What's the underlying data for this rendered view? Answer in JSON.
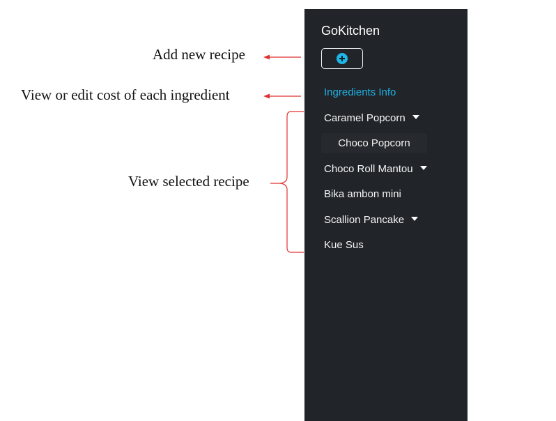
{
  "annotations": {
    "add_recipe": "Add new recipe",
    "view_cost": "View or edit cost of each ingredient",
    "view_recipe": "View selected recipe"
  },
  "sidebar": {
    "brand": "GoKitchen",
    "add_button_icon": "plus-circle-icon",
    "ingredients_info": "Ingredients Info",
    "recipes": [
      {
        "label": "Caramel Popcorn",
        "expandable": true
      },
      {
        "label": "Choco Popcorn",
        "submenu": true
      },
      {
        "label": "Choco Roll Mantou",
        "expandable": true
      },
      {
        "label": "Bika ambon mini",
        "expandable": false
      },
      {
        "label": "Scallion Pancake",
        "expandable": true
      },
      {
        "label": "Kue Sus",
        "expandable": false
      }
    ]
  },
  "colors": {
    "sidebar_bg": "#212529",
    "accent": "#1fb0e4",
    "annotation_arrow": "#e03030"
  }
}
